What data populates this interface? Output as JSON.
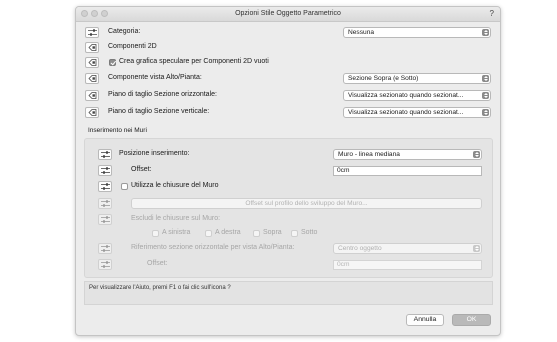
{
  "window": {
    "title": "Opzioni Stile Oggetto Parametrico",
    "help": "?"
  },
  "fields": {
    "categoria_label": "Categoria:",
    "categoria_value": "Nessuna",
    "componenti2d_label": "Componenti 2D",
    "speculare_label": "Crea grafica speculare per Componenti 2D vuoti",
    "vista_label": "Componente vista Alto/Pianta:",
    "vista_value": "Sezione Sopra (e Sotto)",
    "piano_orizz_label": "Piano di taglio Sezione orizzontale:",
    "piano_orizz_value": "Visualizza sezionato quando sezionat...",
    "piano_vert_label": "Piano di taglio Sezione verticale:",
    "piano_vert_value": "Visualizza sezionato quando sezionat..."
  },
  "muri": {
    "title": "Inserimento nei Muri",
    "posizione_label": "Posizione inserimento:",
    "posizione_value": "Muro - linea mediana",
    "offset_label": "Offset:",
    "offset_value": "0cm",
    "chiusure_label": "Utilizza le chiusure del Muro",
    "offset_btn": "Offset sul profilo dello sviluppo del Muro...",
    "escludi_label": "Escludi le chiusure sul Muro:",
    "sinistra": "A sinistra",
    "destra": "A destra",
    "sopra": "Sopra",
    "sotto": "Sotto",
    "riferimento_label": "Riferimento sezione orizzontale per vista Alto/Pianta:",
    "riferimento_value": "Centro oggetto",
    "offset2_label": "Offset:",
    "offset2_value": "0cm"
  },
  "info": {
    "text": "Per visualizzare l'Aiuto, premi F1 o fai clic sull'icona ?"
  },
  "buttons": {
    "cancel": "Annulla",
    "ok": "OK"
  }
}
